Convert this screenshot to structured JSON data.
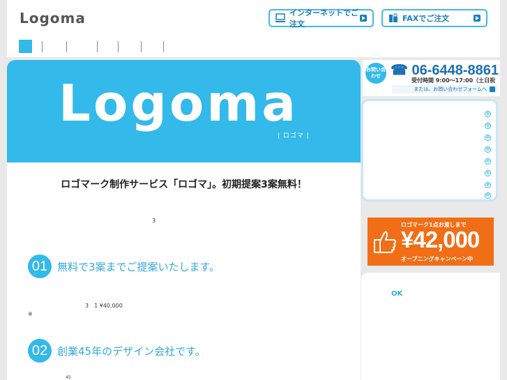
{
  "header": {
    "logo": "Logoma",
    "order_internet": "インターネットでご注文",
    "order_fax": "FAXでご注文"
  },
  "hero": {
    "logo_text": "Logoma",
    "kana": "| ロゴマ |"
  },
  "main": {
    "tagline": "ロゴマーク制作サービス「ロゴマ」。初期提案3案無料！",
    "note_1": "3",
    "note_2": "3　1 ¥40,000",
    "note_3": "※",
    "note_4": "45",
    "features": [
      {
        "num": "01",
        "title": "無料で3案までご提案いたします。"
      },
      {
        "num": "02",
        "title": "創業45年のデザイン会社です。"
      }
    ]
  },
  "contact": {
    "badge": "お問い合わせ",
    "phone": "☎ 06-6448-8861",
    "hours": "受付時間 9:00〜17:00（土日祝除く）",
    "form_link": "または、お問い合わせフォームへ"
  },
  "side_menu": {
    "items": [
      "⊕",
      "⊕",
      "⊕",
      "⊕",
      "⊕",
      "⊕",
      "⊕",
      "⊕"
    ]
  },
  "campaign": {
    "top": "ロゴマーク1点お渡しまで",
    "price": "¥42,000",
    "bottom": "オープニングキャンペーン中"
  },
  "news": {
    "ok": "OK"
  },
  "colors": {
    "accent": "#33b9ea",
    "campaign": "#f16e17",
    "phone": "#1a6fb2"
  }
}
